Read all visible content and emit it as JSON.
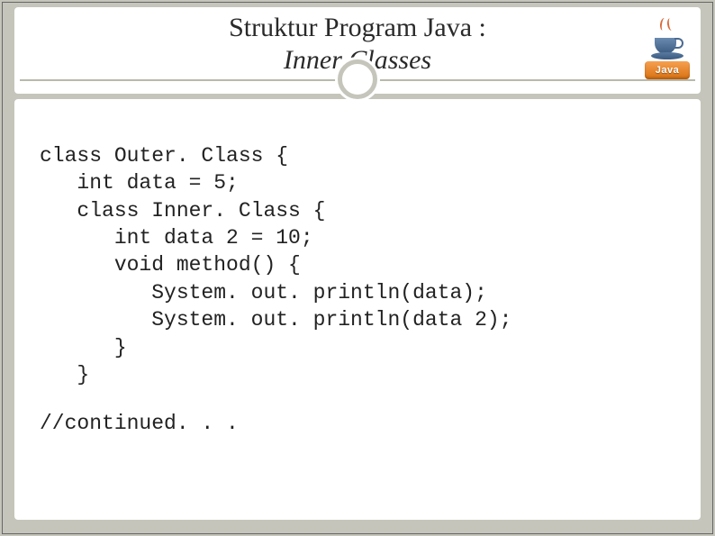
{
  "header": {
    "title_line1": "Struktur Program Java :",
    "title_line2": "Inner Classes"
  },
  "logo": {
    "text": "Java"
  },
  "code": {
    "l1": "class Outer. Class {",
    "l2": "   int data = 5;",
    "l3": "   class Inner. Class {",
    "l4": "      int data 2 = 10;",
    "l5": "      void method() {",
    "l6": "         System. out. println(data);",
    "l7": "         System. out. println(data 2);",
    "l8": "      }",
    "l9": "   }"
  },
  "continued": "//continued. . ."
}
